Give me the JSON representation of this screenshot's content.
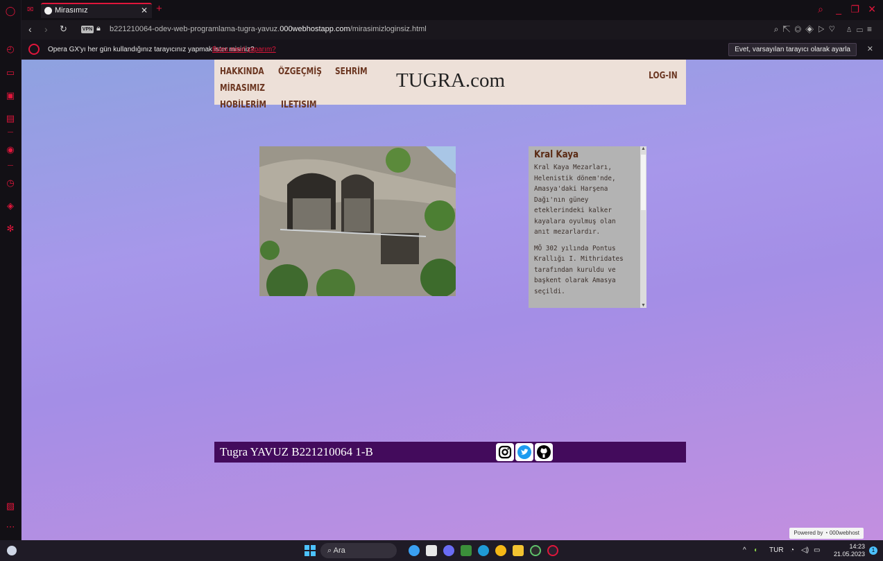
{
  "browser": {
    "tab_title": "Mirasımız",
    "url_prefix": "b221210064-odev-web-programlama-tugra-yavuz.",
    "url_domain": "000webhostapp.com",
    "url_path": "/mirasimizloginsiz.html",
    "vpn_label": "VPN",
    "accent_color": "#e0163b",
    "infobar_text": "Opera GX'yı her gün kullandığınız tarayıcınız yapmak ister misiniz?",
    "infobar_link": "Bunu nasıl yaparım?",
    "infobar_button": "Evet, varsayılan tarayıcı olarak ayarla"
  },
  "site": {
    "nav": [
      "HAKKINDA",
      "ÖZGEÇMİŞ",
      "SEHRİM",
      "MİRASIMIZ",
      "HOBİLERİM",
      "ILETISIM"
    ],
    "brand": "TUGRA.com",
    "login": "LOG-IN",
    "panel_title": "Kral Kaya",
    "panel_paragraphs": [
      "Kral Kaya Mezarları, Helenistik dönem'nde, Amasya'daki Harşena Dağı'nın güney eteklerindeki kalker kayalara oyulmuş olan anıt mezarlardır.",
      "MÖ 302 yılında Pontus Krallığı I. Mithridates tarafından kuruldu ve başkent olarak Amasya seçildi."
    ],
    "footer_text": "Tugra YAVUZ B221210064 1-B",
    "social_icons": [
      "instagram-icon",
      "twitter-icon",
      "github-icon"
    ],
    "powered_by": "Powered by",
    "powered_brand": "000webhost",
    "header_bg": "#ede0d8",
    "footer_bg": "#430b5c"
  },
  "taskbar": {
    "search_placeholder": "Ara",
    "language": "TUR",
    "time": "14:23",
    "date": "21.05.2023",
    "notification_count": "1"
  }
}
